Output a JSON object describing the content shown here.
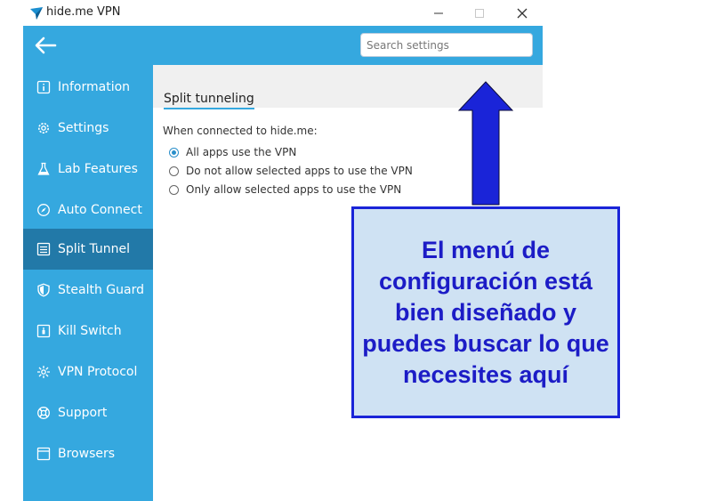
{
  "window": {
    "title": "hide.me VPN"
  },
  "search": {
    "placeholder": "Search settings"
  },
  "sidebar": {
    "items": [
      {
        "label": "Information",
        "icon": "info-icon"
      },
      {
        "label": "Settings",
        "icon": "gear-icon"
      },
      {
        "label": "Lab Features",
        "icon": "flask-icon"
      },
      {
        "label": "Auto Connect",
        "icon": "compass-icon"
      },
      {
        "label": "Split Tunnel",
        "icon": "split-tunnel-icon",
        "active": true
      },
      {
        "label": "Stealth Guard",
        "icon": "shield-icon"
      },
      {
        "label": "Kill Switch",
        "icon": "kill-switch-icon"
      },
      {
        "label": "VPN Protocol",
        "icon": "protocol-icon"
      },
      {
        "label": "Support",
        "icon": "lifebuoy-icon"
      },
      {
        "label": "Browsers",
        "icon": "browser-icon"
      }
    ]
  },
  "main": {
    "section_title": "Split tunneling",
    "connected_label": "When connected to hide.me:",
    "options": [
      {
        "label": "All apps use the VPN",
        "checked": true
      },
      {
        "label": "Do not allow selected apps to use the VPN",
        "checked": false
      },
      {
        "label": "Only allow selected apps to use the VPN",
        "checked": false
      }
    ]
  },
  "annotation": {
    "text": "El menú de configuración está bien diseñado y puedes buscar lo que necesites aquí"
  },
  "colors": {
    "sidebar": "#35a8df",
    "sidebar_active": "#2279a8",
    "annotation_blue": "#1a24d8",
    "annotation_fill": "#cfe2f3"
  }
}
